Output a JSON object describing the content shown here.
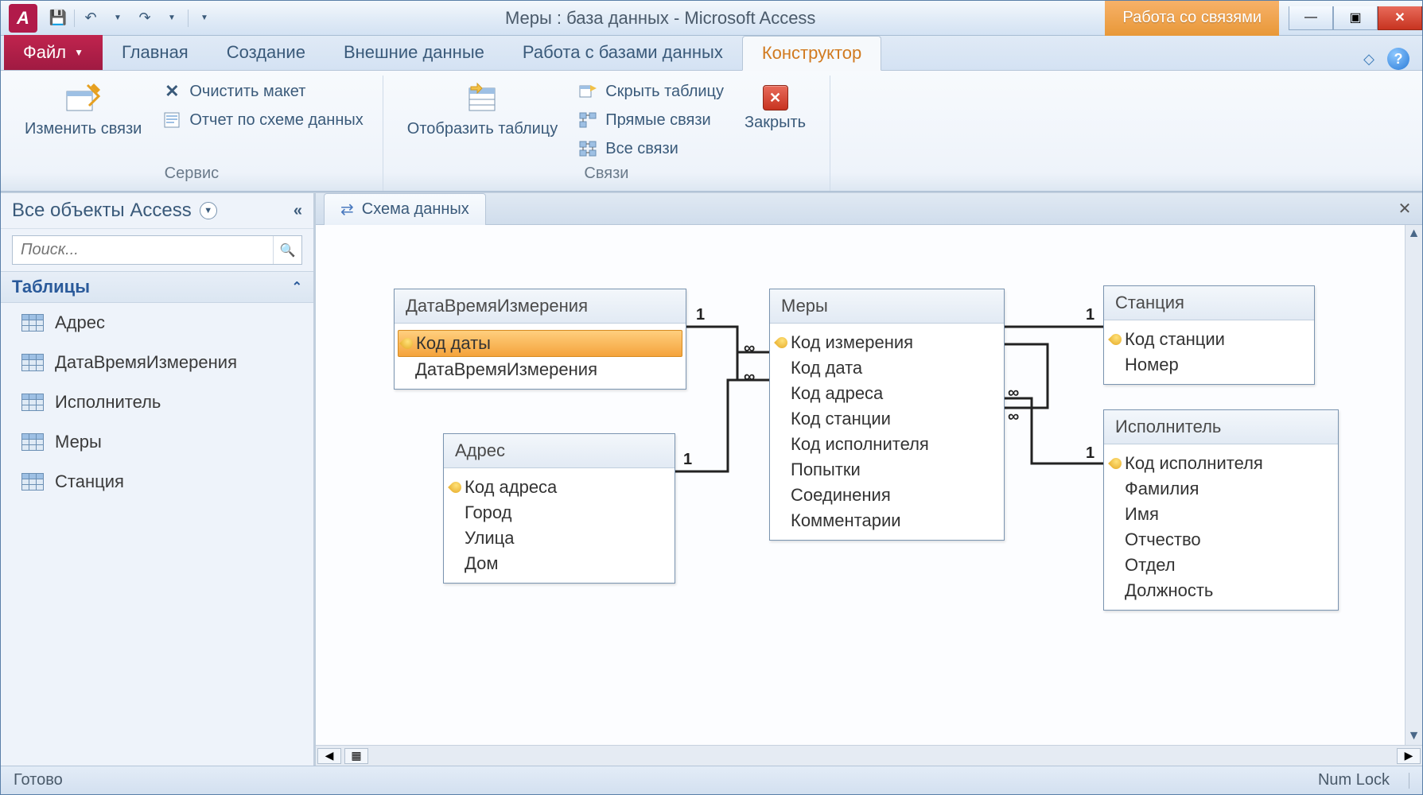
{
  "title": "Меры : база данных  -  Microsoft Access",
  "context_tab": "Работа со связями",
  "ribbon_tabs": {
    "file": "Файл",
    "home": "Главная",
    "create": "Создание",
    "external": "Внешние данные",
    "dbtools": "Работа с базами данных",
    "designer": "Конструктор"
  },
  "ribbon": {
    "tools_group": "Сервис",
    "relations_group": "Связи",
    "edit_relations": "Изменить связи",
    "clear_layout": "Очистить макет",
    "relation_report": "Отчет по схеме данных",
    "show_table": "Отобразить таблицу",
    "hide_table": "Скрыть таблицу",
    "direct_relations": "Прямые связи",
    "all_relations": "Все связи",
    "close": "Закрыть"
  },
  "nav": {
    "header": "Все объекты Access",
    "search_placeholder": "Поиск...",
    "tables_section": "Таблицы",
    "items": [
      "Адрес",
      "ДатаВремяИзмерения",
      "Исполнитель",
      "Меры",
      "Станция"
    ]
  },
  "doc_tab": "Схема данных",
  "tables": {
    "date": {
      "title": "ДатаВремяИзмерения",
      "fields": [
        "Код даты",
        "ДатаВремяИзмерения"
      ],
      "pk": [
        0
      ]
    },
    "addr": {
      "title": "Адрес",
      "fields": [
        "Код адреса",
        "Город",
        "Улица",
        "Дом"
      ],
      "pk": [
        0
      ]
    },
    "measures": {
      "title": "Меры",
      "fields": [
        "Код измерения",
        "Код дата",
        "Код адреса",
        "Код станции",
        "Код исполнителя",
        "Попытки",
        "Соединения",
        "Комментарии"
      ],
      "pk": [
        0
      ]
    },
    "station": {
      "title": "Станция",
      "fields": [
        "Код станции",
        "Номер"
      ],
      "pk": [
        0
      ]
    },
    "performer": {
      "title": "Исполнитель",
      "fields": [
        "Код исполнителя",
        "Фамилия",
        "Имя",
        "Отчество",
        "Отдел",
        "Должность"
      ],
      "pk": [
        0
      ]
    }
  },
  "rel_labels": {
    "one": "1",
    "many": "∞"
  },
  "status": {
    "left": "Готово",
    "numlock": "Num Lock"
  }
}
